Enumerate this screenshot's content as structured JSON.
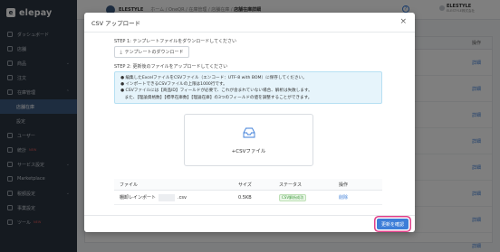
{
  "app": {
    "logo_text": "elepay"
  },
  "sidebar": {
    "items": [
      {
        "label": "ダッシュボード",
        "icon": "dashboard-icon"
      },
      {
        "label": "店舗",
        "icon": "store-icon"
      },
      {
        "label": "商品",
        "icon": "product-icon",
        "chevron": "⌄"
      },
      {
        "label": "注文",
        "icon": "order-icon"
      },
      {
        "label": "在庫管理",
        "icon": "inventory-icon",
        "chevron": "⌃"
      }
    ],
    "sub_items": [
      {
        "label": "店舗在庫",
        "active": true
      },
      {
        "label": "設定",
        "active": false
      }
    ],
    "items_after": [
      {
        "label": "ユーザー",
        "icon": "user-icon"
      },
      {
        "label": "統計",
        "icon": "stats-icon",
        "badge": "NEW"
      },
      {
        "label": "サービス設定",
        "icon": "service-icon",
        "chevron": "⌄"
      },
      {
        "label": "Marketplace",
        "icon": "marketplace-icon"
      },
      {
        "label": "税額設定",
        "icon": "tax-icon",
        "chevron": "⌄"
      },
      {
        "label": "事業設定",
        "icon": "business-icon"
      },
      {
        "label": "ツール",
        "icon": "tool-icon",
        "badge": "NEW"
      }
    ]
  },
  "header": {
    "brand": "ELESTYLE",
    "breadcrumb_prefix": "ホーム / OneQR / 在庫管理 / 店舗在庫 /",
    "breadcrumb_current": "店舗在庫詳細",
    "user_name": "ELESTYLE",
    "user_sub": "ELESTYLE株式会社"
  },
  "background": {
    "header_label": "操作",
    "row_link": "詳細"
  },
  "modal": {
    "title": "CSV アップロード",
    "close_symbol": "×",
    "step1_label": "STEP 1: テンプレートファイルをダウンロードしてください",
    "download_button": "テンプレートのダウンロード",
    "step2_label": "STEP 2: 更新後のファイルをアップロードしてください",
    "notices": [
      "● 編集したExcelファイルをCSVファイル（エンコード：UTF-8 with BOM）に保存してください。",
      "● インポートできるCSVファイルの上限は1000行です。",
      "● CSVファイルには【商品ID】フィールドが必要で、これが含まれていない場合、解析は失敗します。",
      "　また、【理論資格数】【標準在庫数】【理論在庫】の3つのフィールドの値を調整することができます。"
    ],
    "dropzone_label": "+CSVファイル",
    "table": {
      "headers": {
        "file": "ファイル",
        "size": "サイズ",
        "status": "ステータス",
        "op": "操作"
      },
      "rows": [
        {
          "file_prefix": "棚卸レインポート",
          "file_ext": ".csv",
          "size": "0.5KB",
          "status": "CSV解析成功",
          "op": "削除"
        }
      ]
    },
    "confirm_button": "更新を確認"
  },
  "colors": {
    "accent": "#3d7ed8",
    "highlight": "#e0408a",
    "sidebar_bg": "#2b3440"
  }
}
